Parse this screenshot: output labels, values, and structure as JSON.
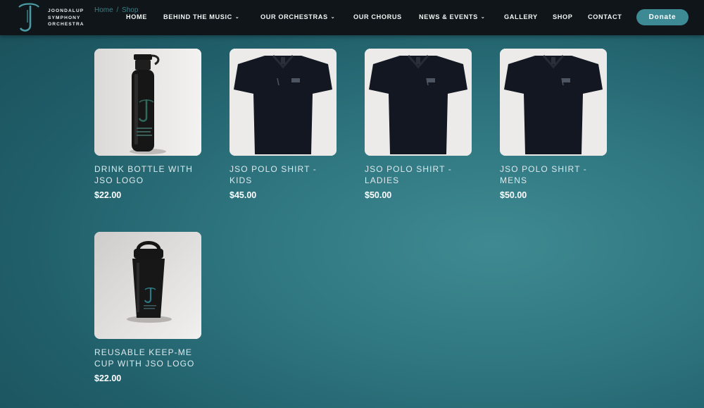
{
  "brand": {
    "line1": "JOONDALUP",
    "line2": "SYMPHONY",
    "line3": "ORCHESTRA",
    "accent": "#3e8a94"
  },
  "breadcrumb": {
    "home": "Home",
    "separator": "/",
    "current": "Shop"
  },
  "nav": {
    "home": "HOME",
    "behind": "BEHIND THE MUSIC",
    "orchestras": "OUR ORCHESTRAS",
    "chorus": "OUR CHORUS",
    "news": "NEWS & EVENTS",
    "gallery": "GALLERY",
    "shop": "SHOP",
    "contact": "CONTACT",
    "donate": "Donate"
  },
  "products": [
    {
      "title": "DRINK BOTTLE WITH JSO LOGO",
      "price": "$22.00",
      "image": "drink-bottle"
    },
    {
      "title": "JSO POLO SHIRT - KIDS",
      "price": "$45.00",
      "image": "polo-shirt"
    },
    {
      "title": "JSO POLO SHIRT - LADIES",
      "price": "$50.00",
      "image": "polo-shirt"
    },
    {
      "title": "JSO POLO SHIRT - MENS",
      "price": "$50.00",
      "image": "polo-shirt"
    },
    {
      "title": "REUSABLE KEEP-ME CUP WITH JSO LOGO",
      "price": "$22.00",
      "image": "keep-cup"
    }
  ]
}
